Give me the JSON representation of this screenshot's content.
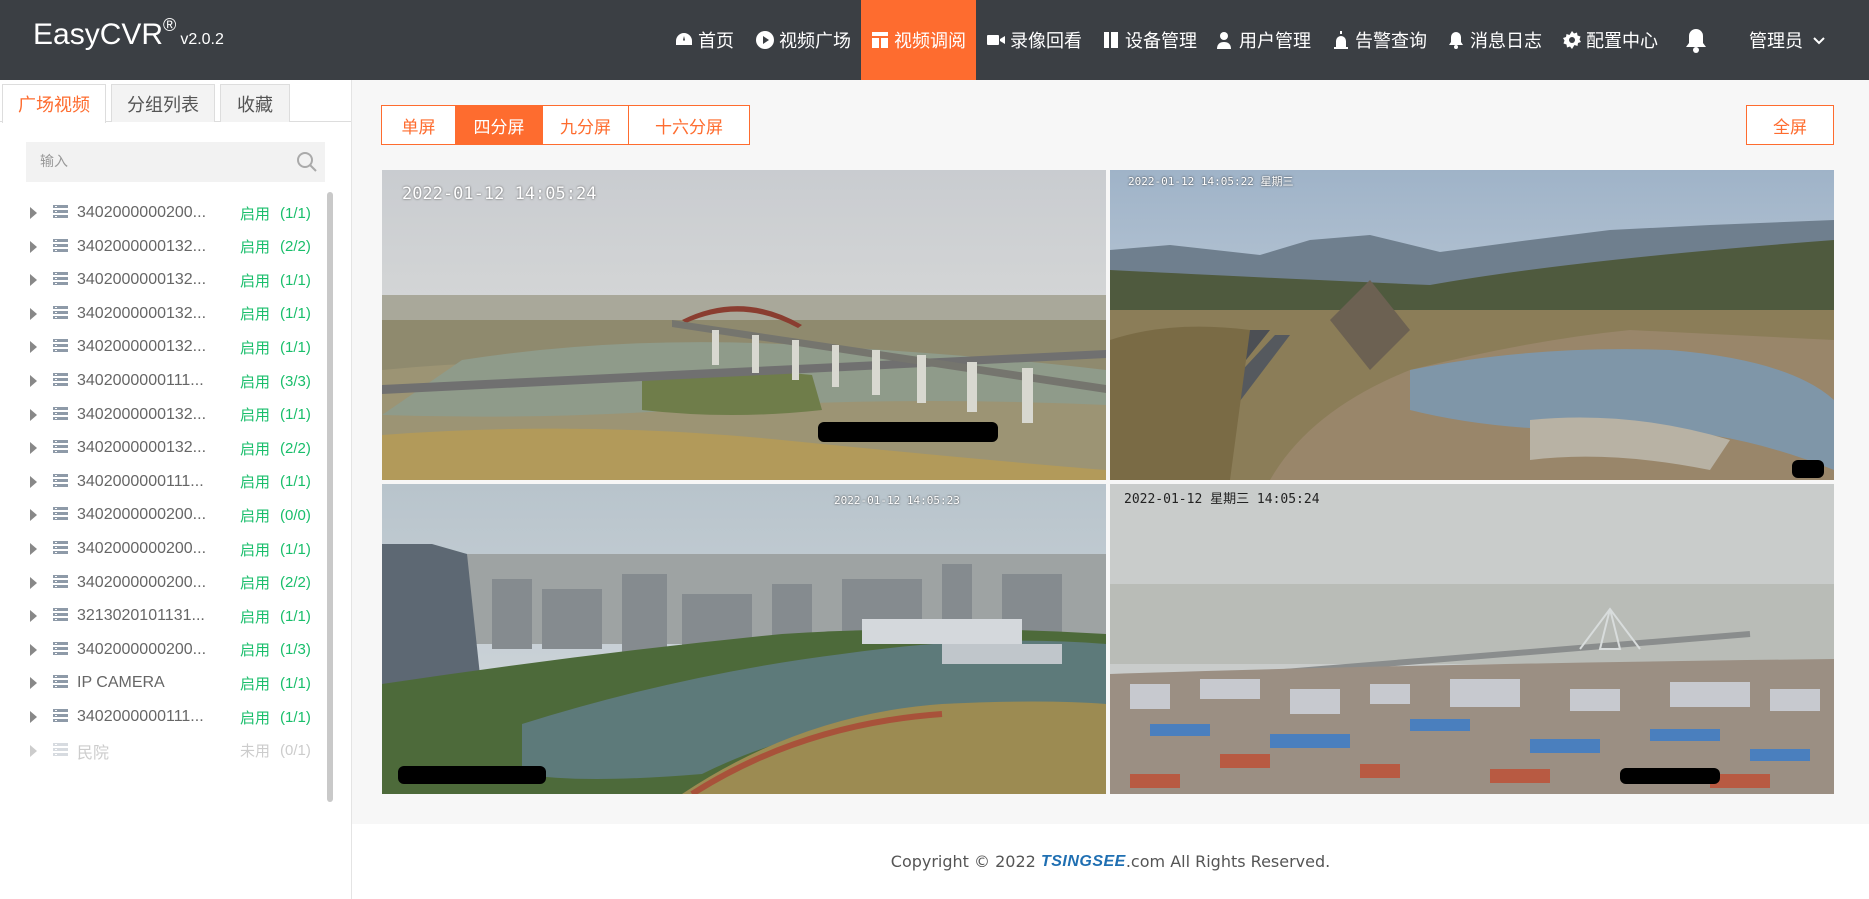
{
  "app": {
    "brand": "EasyCVR",
    "registered": "®",
    "version": "v2.0.2"
  },
  "nav": [
    {
      "label": "首页",
      "icon": "dashboard-icon"
    },
    {
      "label": "视频广场",
      "icon": "play-circle-icon"
    },
    {
      "label": "视频调阅",
      "icon": "layout-icon",
      "active": true
    },
    {
      "label": "录像回看",
      "icon": "video-camera-icon"
    },
    {
      "label": "设备管理",
      "icon": "device-icon"
    },
    {
      "label": "用户管理",
      "icon": "user-icon"
    },
    {
      "label": "告警查询",
      "icon": "alarm-icon"
    },
    {
      "label": "消息日志",
      "icon": "bell-icon"
    },
    {
      "label": "配置中心",
      "icon": "gear-icon"
    }
  ],
  "header": {
    "user": "管理员"
  },
  "sidebar": {
    "tabs": [
      "广场视频",
      "分组列表",
      "收藏"
    ],
    "active_tab": 0,
    "search_placeholder": "输入",
    "devices": [
      {
        "id": "3402000000200...",
        "status": "启用",
        "count": "(1/1)"
      },
      {
        "id": "3402000000132...",
        "status": "启用",
        "count": "(2/2)"
      },
      {
        "id": "3402000000132...",
        "status": "启用",
        "count": "(1/1)"
      },
      {
        "id": "3402000000132...",
        "status": "启用",
        "count": "(1/1)"
      },
      {
        "id": "3402000000132...",
        "status": "启用",
        "count": "(1/1)"
      },
      {
        "id": "3402000000111...",
        "status": "启用",
        "count": "(3/3)"
      },
      {
        "id": "3402000000132...",
        "status": "启用",
        "count": "(1/1)"
      },
      {
        "id": "3402000000132...",
        "status": "启用",
        "count": "(2/2)"
      },
      {
        "id": "3402000000111...",
        "status": "启用",
        "count": "(1/1)"
      },
      {
        "id": "3402000000200...",
        "status": "启用",
        "count": "(0/0)"
      },
      {
        "id": "3402000000200...",
        "status": "启用",
        "count": "(1/1)"
      },
      {
        "id": "3402000000200...",
        "status": "启用",
        "count": "(2/2)"
      },
      {
        "id": "3213020101131...",
        "status": "启用",
        "count": "(1/1)"
      },
      {
        "id": "3402000000200...",
        "status": "启用",
        "count": "(1/3)"
      },
      {
        "id": "IP CAMERA",
        "status": "启用",
        "count": "(1/1)"
      },
      {
        "id": "3402000000111...",
        "status": "启用",
        "count": "(1/1)"
      },
      {
        "id": "民院",
        "status": "未用",
        "count": "(0/1)",
        "disabled": true
      }
    ]
  },
  "toolbar": {
    "split_options": [
      "单屏",
      "四分屏",
      "九分屏",
      "十六分屏"
    ],
    "active_split": 1,
    "fullscreen": "全屏"
  },
  "videos": [
    {
      "overlay": "2022-01-12  14:05:24"
    },
    {
      "overlay": "2022-01-12 14:05:22 星期三"
    },
    {
      "overlay": "2022-01-12 14:05:23"
    },
    {
      "overlay": "2022-01-12 星期三 14:05:24"
    }
  ],
  "footer": {
    "prefix": "Copyright © 2022 ",
    "logo": "TSINGSEE",
    "suffix": ".com All Rights Reserved."
  },
  "colors": {
    "accent": "#fe6c2f",
    "header_bg": "#3b3f44",
    "status_green": "#19be6b"
  }
}
